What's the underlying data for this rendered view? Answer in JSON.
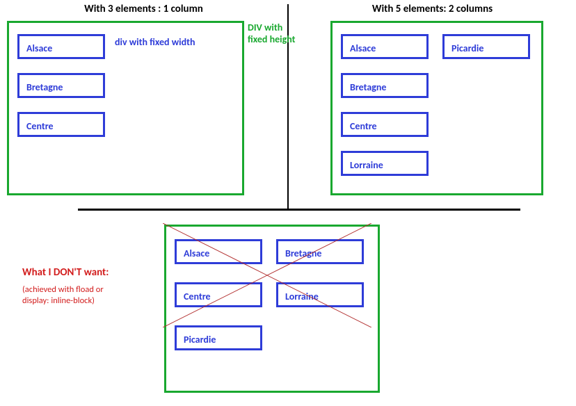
{
  "top_left": {
    "title": "With 3 elements : 1 column",
    "items": [
      "Alsace",
      "Bretagne",
      "Centre"
    ],
    "ann_blue": "div with fixed width",
    "ann_green": "DIV with fixed height"
  },
  "top_right": {
    "title": "With 5 elements: 2 columns",
    "col1": [
      "Alsace",
      "Bretagne",
      "Centre",
      "Lorraine"
    ],
    "col2": [
      "Picardie"
    ]
  },
  "bottom": {
    "row1": [
      "Alsace",
      "Bretagne"
    ],
    "row2": [
      "Centre",
      "Lorraine"
    ],
    "row3": [
      "Picardie"
    ],
    "ann_title": "What I DON'T want:",
    "ann_sub1": "(achieved with fload or",
    "ann_sub2": "display: inline-block)"
  }
}
